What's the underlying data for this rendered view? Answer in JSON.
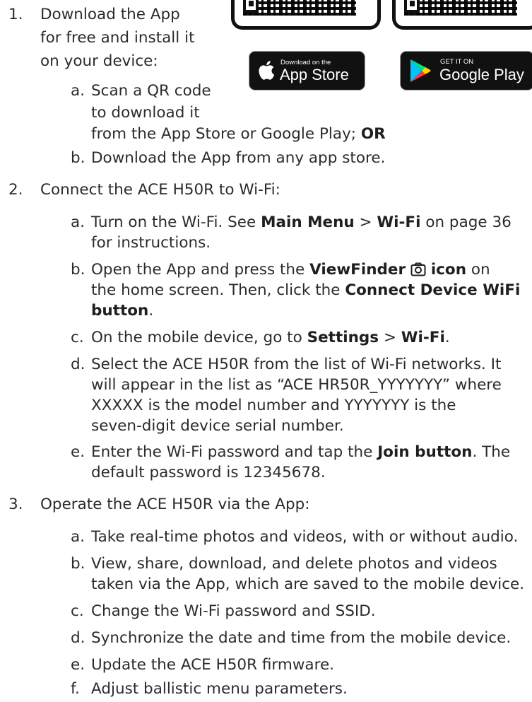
{
  "badges": {
    "apple": {
      "small": "Download on the",
      "big": "App Store"
    },
    "google": {
      "small": "GET IT ON",
      "big": "Google Play"
    }
  },
  "step1": {
    "num": "1.",
    "lines": [
      "Download the App",
      "for free and install it",
      "on your device:"
    ],
    "a": {
      "letter": "a.",
      "l1": "Scan a QR code",
      "l2": "to download it",
      "l3_text": "from the App Store or Google Play; ",
      "l3_bold": "OR"
    },
    "b": {
      "letter": "b.",
      "text": "Download the App from any app store."
    }
  },
  "step2": {
    "num": "2.",
    "text": "Connect the ACE H50R to Wi-Fi:",
    "a": {
      "letter": "a.",
      "t1": "Turn on the Wi-Fi. See ",
      "b1": "Main Menu",
      "t2": " > ",
      "b2": "Wi-Fi",
      "t3": " on page 36",
      "l2": "for instructions."
    },
    "b": {
      "letter": "b.",
      "t1": "Open the App and press the ",
      "b1": "ViewFinder",
      "b2": "icon",
      "t2": " on",
      "l2_text": "the home screen. Then, click the ",
      "l2_bold": "Connect Device WiFi",
      "l3_bold": "button",
      "l3_text": "."
    },
    "c": {
      "letter": "c.",
      "t1": "On the mobile device, go to ",
      "b1": "Settings",
      "t2": " > ",
      "b2": "Wi-Fi",
      "t3": "."
    },
    "d": {
      "letter": "d.",
      "l1": "Select the ACE H50R from the list of Wi-Fi networks. It",
      "l2": "will appear in the list as “ACE HR50R_YYYYYYY” where",
      "l3": "XXXXX is the model number and YYYYYYY is the",
      "l4": "seven-digit device serial number."
    },
    "e": {
      "letter": "e.",
      "t1": "Enter the Wi-Fi password and tap the ",
      "b1": "Join button",
      "t2": ". The",
      "l2": "default password is 12345678."
    }
  },
  "step3": {
    "num": "3.",
    "text": "Operate the ACE H50R via the App:",
    "a": {
      "letter": "a.",
      "text": "Take real-time photos and videos, with or without audio."
    },
    "b": {
      "letter": "b.",
      "l1": "View, share, download, and delete photos and videos",
      "l2": "taken via the App, which are saved to the mobile device."
    },
    "c": {
      "letter": "c.",
      "text": "Change the Wi-Fi password and SSID."
    },
    "d": {
      "letter": "d.",
      "text": "Synchronize the date and time from the mobile device."
    },
    "e": {
      "letter": "e.",
      "text": "Update the ACE H50R firmware."
    },
    "f": {
      "letter": "f.",
      "text": "Adjust ballistic menu parameters."
    }
  }
}
